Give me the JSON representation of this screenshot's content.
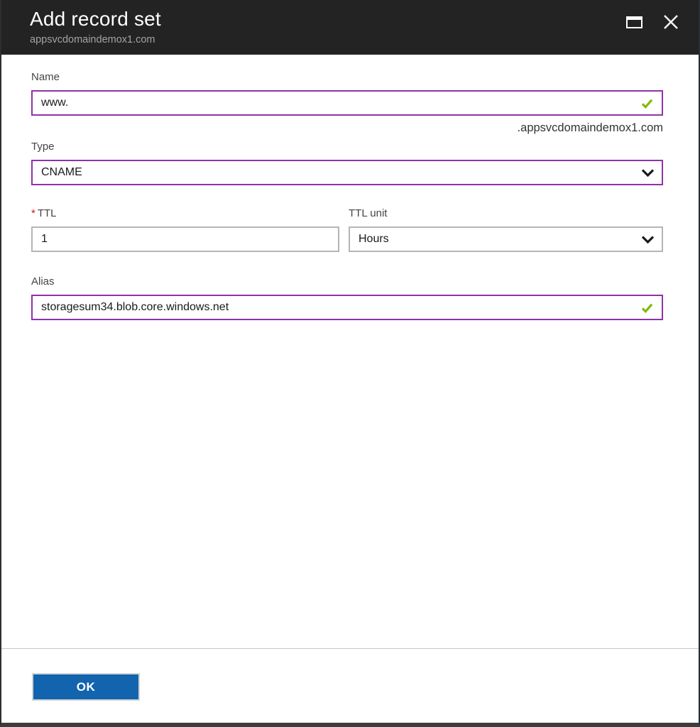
{
  "header": {
    "title": "Add record set",
    "subtitle": "appsvcdomaindemox1.com",
    "icons": [
      "restore-window-icon",
      "close-icon"
    ]
  },
  "form": {
    "name": {
      "label": "Name",
      "value": "www.",
      "suffix": ".appsvcdomaindemox1.com",
      "validation": "valid"
    },
    "type": {
      "label": "Type",
      "selected_value": "CNAME"
    },
    "ttl": {
      "required_marker": "*",
      "label": "TTL",
      "value": "1"
    },
    "ttl_unit": {
      "label": "TTL unit",
      "selected_value": "Hours"
    },
    "alias": {
      "label": "Alias",
      "value": "storagesum34.blob.core.windows.net",
      "validation": "valid"
    }
  },
  "footer": {
    "ok_label": "OK"
  },
  "colors": {
    "header_bg": "#232323",
    "edited_field_border": "#8f32ab",
    "default_field_border": "#b5b5b5",
    "valid_green": "#7fba00",
    "required_red": "#e00b1c",
    "primary_button_blue": "#1264ae"
  }
}
